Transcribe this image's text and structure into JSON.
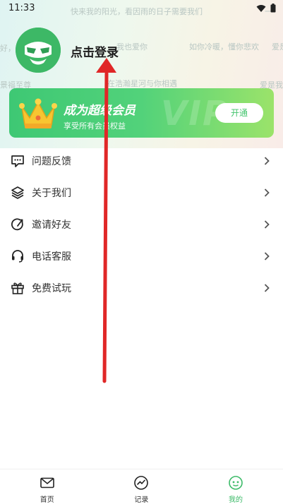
{
  "status": {
    "time": "11:33"
  },
  "barrage": [
    "快来我的阳光，看因雨的日子需要我们",
    "好，",
    "我也爱你",
    "如你冷暖，懂你悲欢",
    "景福至尊",
    "在浩瀚星河与你相遇",
    "爱是我",
    "一",
    "爱是无"
  ],
  "profile": {
    "login_text": "点击登录"
  },
  "vip": {
    "title": "成为超级会员",
    "subtitle": "享受所有会员权益",
    "button": "开通",
    "watermark": "VIP"
  },
  "menu": [
    {
      "label": "问题反馈",
      "icon": "feedback-icon"
    },
    {
      "label": "关于我们",
      "icon": "layers-icon"
    },
    {
      "label": "邀请好友",
      "icon": "share-icon"
    },
    {
      "label": "电话客服",
      "icon": "headset-icon"
    },
    {
      "label": "免费试玩",
      "icon": "gift-icon"
    }
  ],
  "nav": [
    {
      "label": "首页",
      "icon": "mail-icon"
    },
    {
      "label": "记录",
      "icon": "chart-icon"
    },
    {
      "label": "我的",
      "icon": "mine-icon",
      "active": true
    }
  ],
  "colors": {
    "accent": "#3dbb69",
    "arrow": "#e02727"
  }
}
